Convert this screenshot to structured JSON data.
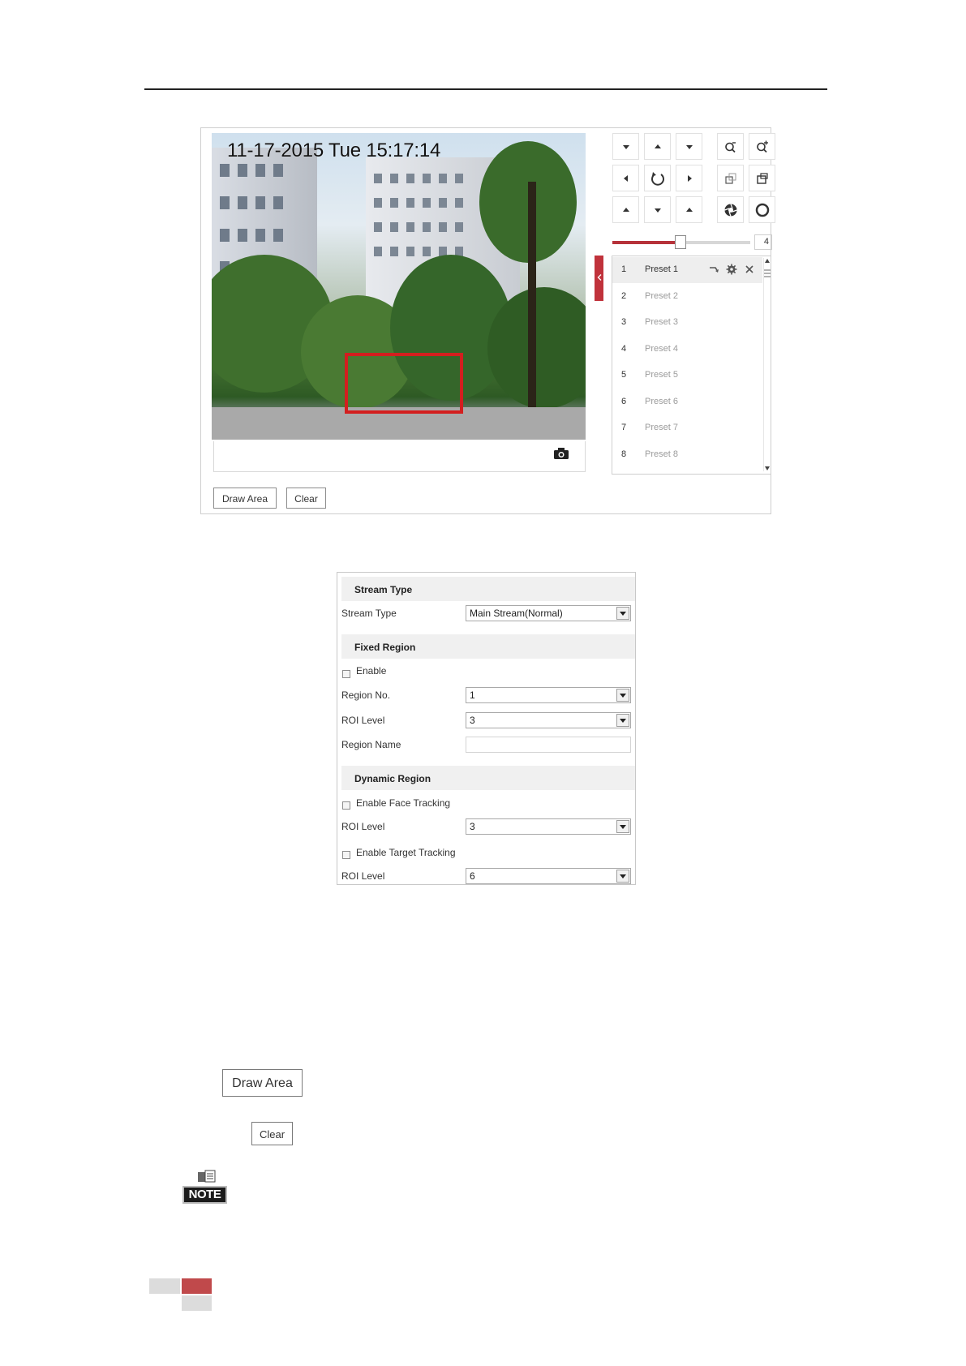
{
  "live_view": {
    "osd_timestamp": "11-17-2015 Tue 15:17:14",
    "buttons": {
      "draw_area": "Draw Area",
      "clear": "Clear"
    },
    "ptz": {
      "zoom_speed_value": "4",
      "zoom_speed_level": 0.5
    },
    "presets": [
      {
        "number": "1",
        "name": "Preset 1",
        "active": true
      },
      {
        "number": "2",
        "name": "Preset 2",
        "active": false
      },
      {
        "number": "3",
        "name": "Preset 3",
        "active": false
      },
      {
        "number": "4",
        "name": "Preset 4",
        "active": false
      },
      {
        "number": "5",
        "name": "Preset 5",
        "active": false
      },
      {
        "number": "6",
        "name": "Preset 6",
        "active": false
      },
      {
        "number": "7",
        "name": "Preset 7",
        "active": false
      },
      {
        "number": "8",
        "name": "Preset 8",
        "active": false
      }
    ]
  },
  "roi_form": {
    "stream_type_section": {
      "title": "Stream Type",
      "stream_type_label": "Stream Type",
      "stream_type_value": "Main Stream(Normal)"
    },
    "fixed_region_section": {
      "title": "Fixed Region",
      "enable_label": "Enable",
      "region_no_label": "Region No.",
      "region_no_value": "1",
      "roi_level_label": "ROI Level",
      "roi_level_value": "3",
      "region_name_label": "Region Name",
      "region_name_value": ""
    },
    "dynamic_region_section": {
      "title": "Dynamic Region",
      "face_tracking_label": "Enable Face Tracking",
      "face_roi_level_label": "ROI Level",
      "face_roi_level_value": "3",
      "target_tracking_label": "Enable Target Tracking",
      "target_roi_level_label": "ROI Level",
      "target_roi_level_value": "6"
    }
  },
  "inline_buttons": {
    "draw_area": "Draw Area",
    "clear": "Clear"
  },
  "note": {
    "label": "NOTE"
  },
  "colors": {
    "accent_red": "#c0323b",
    "roi_box": "#d31f1f"
  }
}
